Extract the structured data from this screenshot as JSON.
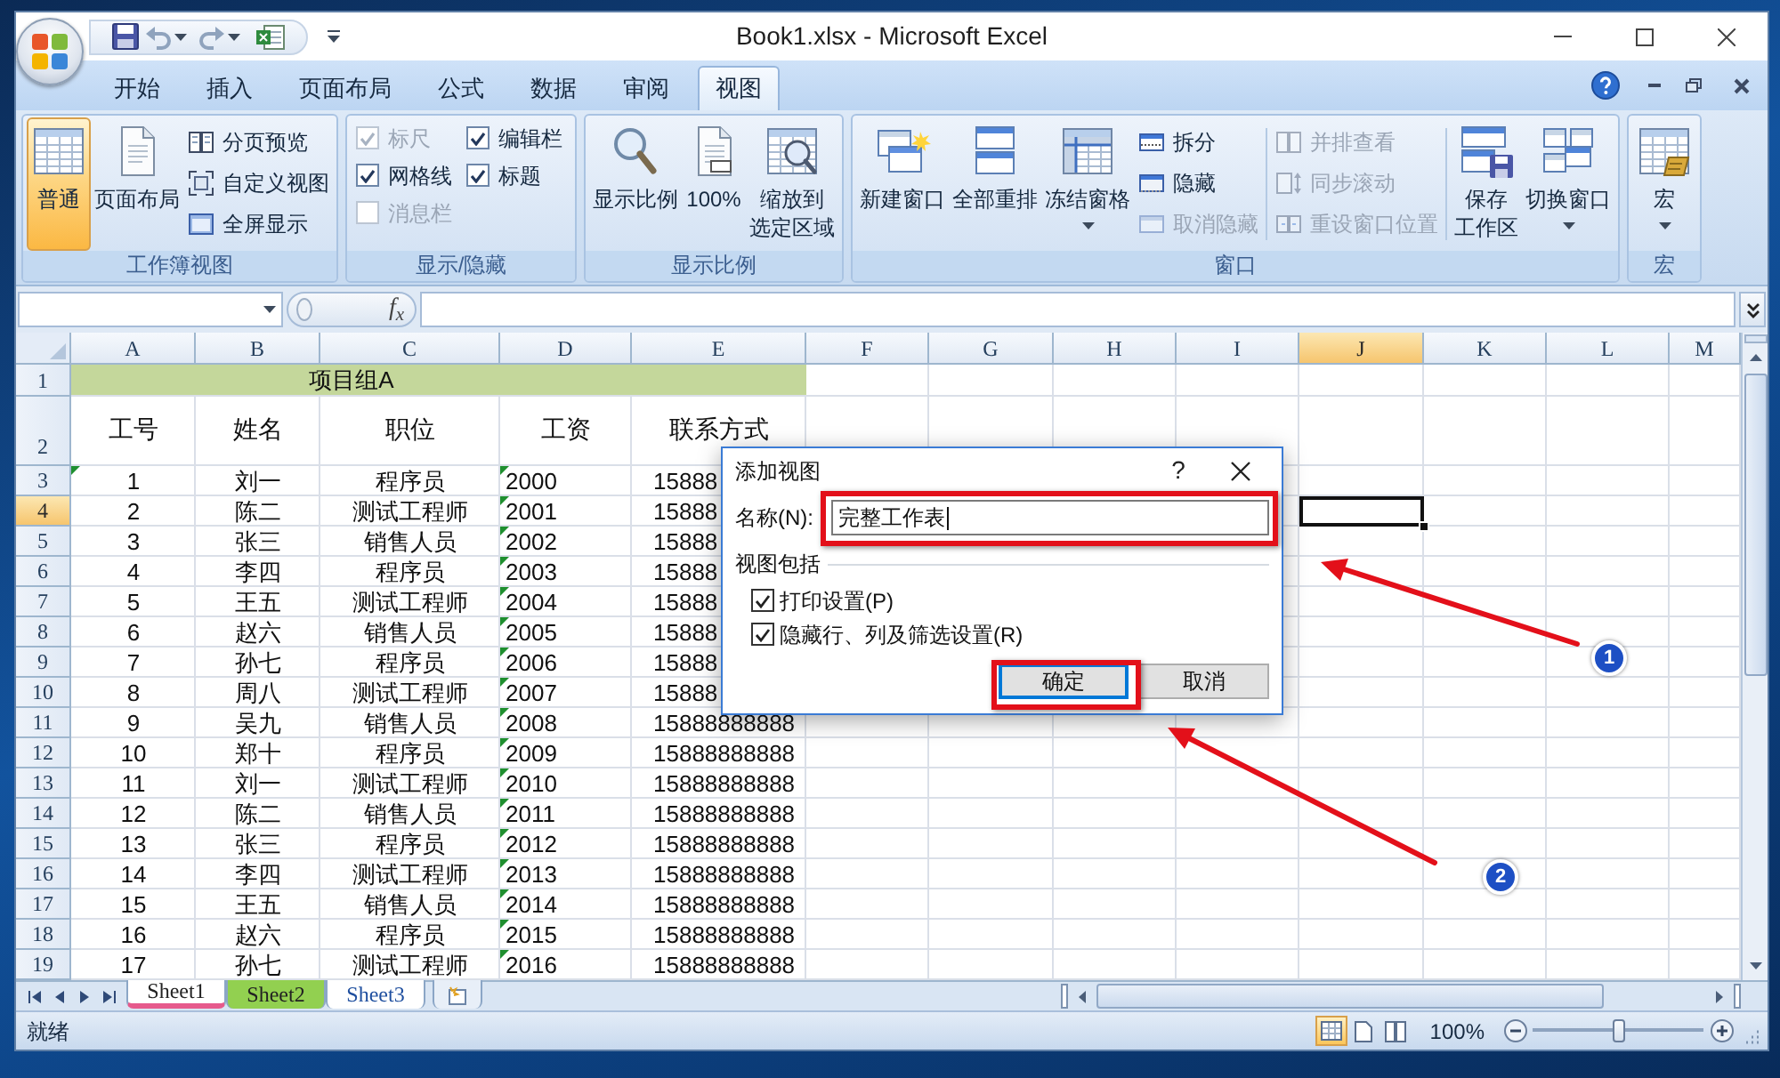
{
  "window": {
    "title": "Book1.xlsx - Microsoft Excel"
  },
  "ribbon": {
    "tabs": [
      {
        "label": "开始",
        "selected": false
      },
      {
        "label": "插入",
        "selected": false
      },
      {
        "label": "页面布局",
        "selected": false
      },
      {
        "label": "公式",
        "selected": false
      },
      {
        "label": "数据",
        "selected": false
      },
      {
        "label": "审阅",
        "selected": false
      },
      {
        "label": "视图",
        "selected": true
      }
    ],
    "groups": [
      {
        "label": "工作簿视图",
        "columns": [
          [
            {
              "kind": "large",
              "lines": [
                "普通"
              ],
              "selected": true,
              "dropdown": false
            }
          ],
          [
            {
              "kind": "large",
              "lines": [
                "页面布局"
              ],
              "selected": false,
              "dropdown": false
            }
          ],
          [
            {
              "kind": "small",
              "label": "分页预览",
              "disabled": false
            },
            {
              "kind": "small",
              "label": "自定义视图",
              "disabled": false
            },
            {
              "kind": "small",
              "label": "全屏显示",
              "disabled": false
            }
          ]
        ]
      },
      {
        "label": "显示/隐藏",
        "columns": [
          [
            {
              "kind": "check",
              "label": "标尺",
              "checked": true,
              "disabled": true
            },
            {
              "kind": "check",
              "label": "网格线",
              "checked": true,
              "disabled": false
            },
            {
              "kind": "check",
              "label": "消息栏",
              "checked": false,
              "disabled": true
            }
          ],
          [
            {
              "kind": "check",
              "label": "编辑栏",
              "checked": true,
              "disabled": false
            },
            {
              "kind": "check",
              "label": "标题",
              "checked": true,
              "disabled": false
            }
          ]
        ]
      },
      {
        "label": "显示比例",
        "columns": [
          [
            {
              "kind": "large",
              "lines": [
                "显示比例"
              ],
              "selected": false,
              "dropdown": false
            }
          ],
          [
            {
              "kind": "large",
              "lines": [
                "100%"
              ],
              "selected": false,
              "dropdown": false
            }
          ],
          [
            {
              "kind": "large",
              "lines": [
                "缩放到",
                "选定区域"
              ],
              "selected": false,
              "dropdown": false
            }
          ]
        ]
      },
      {
        "label": "窗口",
        "columns": [
          [
            {
              "kind": "large",
              "lines": [
                "新建窗口"
              ],
              "selected": false,
              "dropdown": false
            }
          ],
          [
            {
              "kind": "large",
              "lines": [
                "全部重排"
              ],
              "selected": false,
              "dropdown": false
            }
          ],
          [
            {
              "kind": "large",
              "lines": [
                "冻结窗格"
              ],
              "selected": false,
              "dropdown": true
            }
          ],
          [
            {
              "kind": "small",
              "label": "拆分",
              "disabled": false
            },
            {
              "kind": "small",
              "label": "隐藏",
              "disabled": false
            },
            {
              "kind": "small",
              "label": "取消隐藏",
              "disabled": true
            }
          ],
          [
            {
              "kind": "small",
              "label": "并排查看",
              "disabled": true
            },
            {
              "kind": "small",
              "label": "同步滚动",
              "disabled": true
            },
            {
              "kind": "small",
              "label": "重设窗口位置",
              "disabled": true
            }
          ],
          [
            {
              "kind": "large",
              "lines": [
                "保存",
                "工作区"
              ],
              "selected": false,
              "dropdown": false
            }
          ],
          [
            {
              "kind": "large",
              "lines": [
                "切换窗口"
              ],
              "selected": false,
              "dropdown": true
            }
          ]
        ]
      },
      {
        "label": "宏",
        "columns": [
          [
            {
              "kind": "large",
              "lines": [
                "宏"
              ],
              "selected": false,
              "dropdown": true
            }
          ]
        ]
      }
    ]
  },
  "formula_bar": {
    "function_button": "f$_{x}$"
  },
  "sheet": {
    "columns": [
      {
        "label": "A",
        "selected": false
      },
      {
        "label": "B",
        "selected": false
      },
      {
        "label": "C",
        "selected": false
      },
      {
        "label": "D",
        "selected": false
      },
      {
        "label": "E",
        "selected": false
      },
      {
        "label": "F",
        "selected": false
      },
      {
        "label": "G",
        "selected": false
      },
      {
        "label": "H",
        "selected": false
      },
      {
        "label": "I",
        "selected": false
      },
      {
        "label": "J",
        "selected": true
      },
      {
        "label": "K",
        "selected": false
      },
      {
        "label": "L",
        "selected": false
      },
      {
        "label": "M",
        "selected": false
      }
    ],
    "rows": [
      {
        "label": "1",
        "selected": false,
        "kind": "title",
        "title": "项目组A"
      },
      {
        "label": "2",
        "selected": false,
        "kind": "header",
        "cells": [
          "工号",
          "姓名",
          "职位",
          "工资",
          "联系方式"
        ]
      },
      {
        "label": "3",
        "selected": false,
        "kind": "data",
        "cells": [
          "1",
          "刘一",
          "程序员",
          "2000",
          "15888"
        ],
        "flags": [
          true,
          false,
          false,
          true,
          false
        ]
      },
      {
        "label": "4",
        "selected": true,
        "kind": "data",
        "cells": [
          "2",
          "陈二",
          "测试工程师",
          "2001",
          "15888"
        ],
        "flags": [
          false,
          false,
          false,
          true,
          false
        ]
      },
      {
        "label": "5",
        "selected": false,
        "kind": "data",
        "cells": [
          "3",
          "张三",
          "销售人员",
          "2002",
          "15888"
        ],
        "flags": [
          false,
          false,
          false,
          true,
          false
        ]
      },
      {
        "label": "6",
        "selected": false,
        "kind": "data",
        "cells": [
          "4",
          "李四",
          "程序员",
          "2003",
          "15888"
        ],
        "flags": [
          false,
          false,
          false,
          true,
          false
        ]
      },
      {
        "label": "7",
        "selected": false,
        "kind": "data",
        "cells": [
          "5",
          "王五",
          "测试工程师",
          "2004",
          "15888"
        ],
        "flags": [
          false,
          false,
          false,
          true,
          false
        ]
      },
      {
        "label": "8",
        "selected": false,
        "kind": "data",
        "cells": [
          "6",
          "赵六",
          "销售人员",
          "2005",
          "15888"
        ],
        "flags": [
          false,
          false,
          false,
          true,
          false
        ]
      },
      {
        "label": "9",
        "selected": false,
        "kind": "data",
        "cells": [
          "7",
          "孙七",
          "程序员",
          "2006",
          "15888"
        ],
        "flags": [
          false,
          false,
          false,
          true,
          false
        ]
      },
      {
        "label": "10",
        "selected": false,
        "kind": "data",
        "cells": [
          "8",
          "周八",
          "测试工程师",
          "2007",
          "15888"
        ],
        "flags": [
          false,
          false,
          false,
          true,
          false
        ]
      },
      {
        "label": "11",
        "selected": false,
        "kind": "data",
        "cells": [
          "9",
          "吴九",
          "销售人员",
          "2008",
          "15888888888"
        ],
        "flags": [
          false,
          false,
          false,
          true,
          false
        ]
      },
      {
        "label": "12",
        "selected": false,
        "kind": "data",
        "cells": [
          "10",
          "郑十",
          "程序员",
          "2009",
          "15888888888"
        ],
        "flags": [
          false,
          false,
          false,
          true,
          false
        ]
      },
      {
        "label": "13",
        "selected": false,
        "kind": "data",
        "cells": [
          "11",
          "刘一",
          "测试工程师",
          "2010",
          "15888888888"
        ],
        "flags": [
          false,
          false,
          false,
          true,
          false
        ]
      },
      {
        "label": "14",
        "selected": false,
        "kind": "data",
        "cells": [
          "12",
          "陈二",
          "销售人员",
          "2011",
          "15888888888"
        ],
        "flags": [
          false,
          false,
          false,
          true,
          false
        ]
      },
      {
        "label": "15",
        "selected": false,
        "kind": "data",
        "cells": [
          "13",
          "张三",
          "程序员",
          "2012",
          "15888888888"
        ],
        "flags": [
          false,
          false,
          false,
          true,
          false
        ]
      },
      {
        "label": "16",
        "selected": false,
        "kind": "data",
        "cells": [
          "14",
          "李四",
          "测试工程师",
          "2013",
          "15888888888"
        ],
        "flags": [
          false,
          false,
          false,
          true,
          false
        ]
      },
      {
        "label": "17",
        "selected": false,
        "kind": "data",
        "cells": [
          "15",
          "王五",
          "销售人员",
          "2014",
          "15888888888"
        ],
        "flags": [
          false,
          false,
          false,
          true,
          false
        ]
      },
      {
        "label": "18",
        "selected": false,
        "kind": "data",
        "cells": [
          "16",
          "赵六",
          "程序员",
          "2015",
          "15888888888"
        ],
        "flags": [
          false,
          false,
          false,
          true,
          false
        ]
      },
      {
        "label": "19",
        "selected": false,
        "kind": "data",
        "cells": [
          "17",
          "孙七",
          "测试工程师",
          "2016",
          "15888888888"
        ],
        "flags": [
          false,
          false,
          false,
          true,
          false
        ]
      }
    ]
  },
  "sheet_tabs": [
    {
      "label": "Sheet1",
      "selected": true,
      "color": "#e65a8c"
    },
    {
      "label": "Sheet2",
      "selected": false,
      "color": "#92d050"
    },
    {
      "label": "Sheet3",
      "selected": false
    }
  ],
  "status_bar": {
    "status": "就绪",
    "views": [
      {
        "selected": true
      },
      {
        "selected": false
      },
      {
        "selected": false
      }
    ],
    "zoom": {
      "reading": "100%",
      "level": 0.5
    }
  },
  "dialog": {
    "title": "添加视图",
    "help": "?",
    "name_label": "名称(N):",
    "name_value": "完整工作表",
    "group_label": "视图包括",
    "options": [
      {
        "label": "打印设置(P)",
        "checked": true
      },
      {
        "label": "隐藏行、列及筛选设置(R)",
        "checked": true
      }
    ],
    "buttons": [
      {
        "label": "确定",
        "default": true
      },
      {
        "label": "取消",
        "default": false
      }
    ]
  },
  "annotations": {
    "markers": [
      {
        "label": "1"
      },
      {
        "label": "2"
      }
    ]
  }
}
